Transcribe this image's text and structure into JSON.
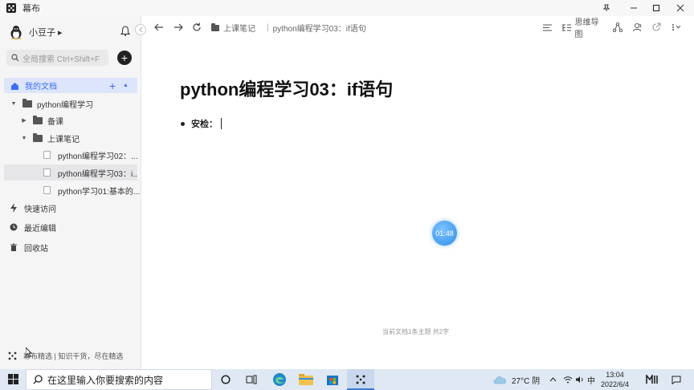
{
  "window": {
    "title": "幕布"
  },
  "sidebar": {
    "user_name": "小豆子 ▸",
    "search_placeholder": "全局搜索 Ctrl+Shift+F",
    "my_docs": "我的文档",
    "tree": [
      {
        "label": "python编程学习"
      },
      {
        "label": "备课"
      },
      {
        "label": "上课笔记"
      },
      {
        "label": "python编程学习02：..."
      },
      {
        "label": "python编程学习03：i..."
      },
      {
        "label": "python学习01:基本的..."
      }
    ],
    "nav": [
      {
        "label": "快速访问"
      },
      {
        "label": "最近编辑"
      },
      {
        "label": "回收站"
      }
    ],
    "footer": "幕布精选 | 知识干货，尽在精选"
  },
  "toolbar": {
    "breadcrumb_folder": "上课笔记",
    "breadcrumb_doc": "python编程学习03：if语句",
    "mindmap_label": "思维导图"
  },
  "document": {
    "title": "python编程学习03：if语句",
    "bullets": [
      {
        "text": "安检："
      }
    ],
    "stats": "当前文档1条主题 共2字"
  },
  "timer": {
    "text": "01:48"
  },
  "taskbar": {
    "search_placeholder": "在这里输入你要搜索的内容",
    "weather": "27°C 阴",
    "ime": "中",
    "time": "13:04",
    "date": "2022/6/4"
  },
  "colors": {
    "accent": "#3b6ef5",
    "selected_bg": "#dde5fb",
    "timer_blue": "#2f8de8"
  }
}
